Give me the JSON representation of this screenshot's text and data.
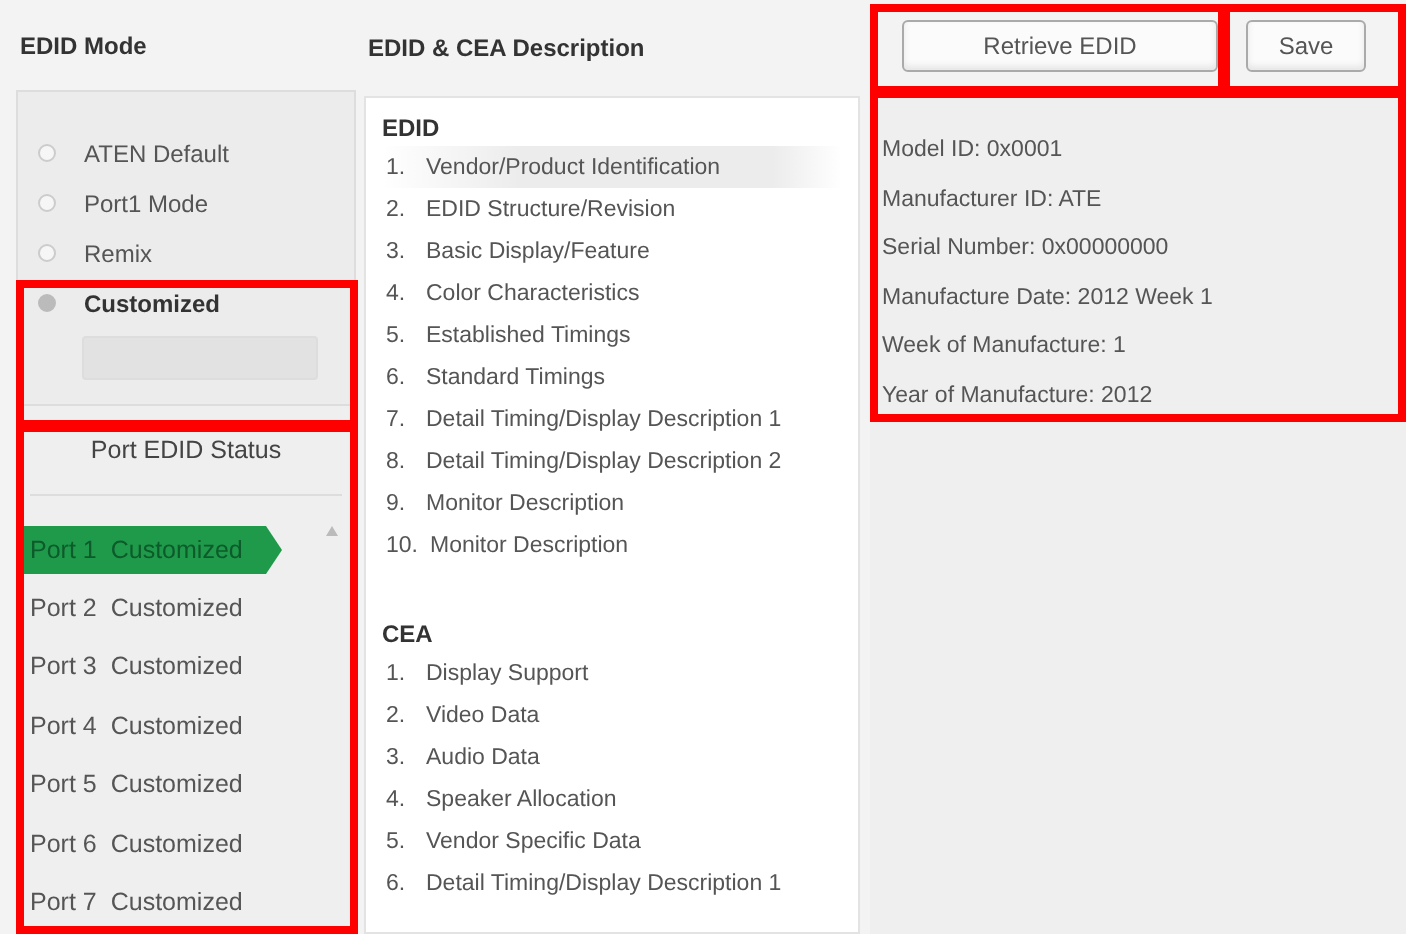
{
  "edid_mode": {
    "title": "EDID Mode",
    "options": [
      {
        "label": "ATEN Default",
        "selected": false
      },
      {
        "label": "Port1 Mode",
        "selected": false
      },
      {
        "label": "Remix",
        "selected": false
      },
      {
        "label": "Customized",
        "selected": true
      }
    ],
    "edit_button": {
      "disabled": true
    }
  },
  "port_status": {
    "title": "Port EDID Status",
    "ports": [
      {
        "port": "Port 1",
        "mode": "Customized",
        "selected": true
      },
      {
        "port": "Port 2",
        "mode": "Customized",
        "selected": false
      },
      {
        "port": "Port 3",
        "mode": "Customized",
        "selected": false
      },
      {
        "port": "Port 4",
        "mode": "Customized",
        "selected": false
      },
      {
        "port": "Port 5",
        "mode": "Customized",
        "selected": false
      },
      {
        "port": "Port 6",
        "mode": "Customized",
        "selected": false
      },
      {
        "port": "Port 7",
        "mode": "Customized",
        "selected": false
      }
    ]
  },
  "description": {
    "title": "EDID & CEA Description",
    "sections": [
      {
        "heading": "EDID",
        "items": [
          {
            "number": "1.",
            "label": "Vendor/Product Identification",
            "selected": true
          },
          {
            "number": "2.",
            "label": "EDID Structure/Revision",
            "selected": false
          },
          {
            "number": "3.",
            "label": "Basic Display/Feature",
            "selected": false
          },
          {
            "number": "4.",
            "label": "Color Characteristics",
            "selected": false
          },
          {
            "number": "5.",
            "label": "Established Timings",
            "selected": false
          },
          {
            "number": "6.",
            "label": "Standard Timings",
            "selected": false
          },
          {
            "number": "7.",
            "label": "Detail Timing/Display Description 1",
            "selected": false
          },
          {
            "number": "8.",
            "label": "Detail Timing/Display Description 2",
            "selected": false
          },
          {
            "number": "9.",
            "label": "Monitor Description",
            "selected": false
          },
          {
            "number": "10.",
            "label": "Monitor Description",
            "selected": false
          }
        ]
      },
      {
        "heading": "CEA",
        "items": [
          {
            "number": "1.",
            "label": "Display Support",
            "selected": false
          },
          {
            "number": "2.",
            "label": "Video Data",
            "selected": false
          },
          {
            "number": "3.",
            "label": "Audio Data",
            "selected": false
          },
          {
            "number": "4.",
            "label": "Speaker Allocation",
            "selected": false
          },
          {
            "number": "5.",
            "label": "Vendor Specific Data",
            "selected": false
          },
          {
            "number": "6.",
            "label": "Detail Timing/Display Description 1",
            "selected": false
          }
        ]
      }
    ]
  },
  "buttons": [
    "Retrieve EDID",
    "Save"
  ],
  "details": [
    "Model ID: 0x0001",
    "Manufacturer ID: ATE",
    "Serial Number: 0x00000000",
    "Manufacture Date: 2012 Week 1",
    "Week of Manufacture: 1",
    "Year of Manufacture: 2012"
  ]
}
